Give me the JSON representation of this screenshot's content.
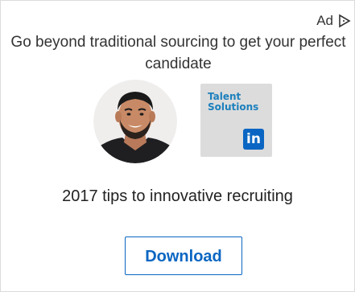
{
  "ad": {
    "label": "Ad",
    "label_icon": "play-triangle-icon",
    "headline": "Go beyond traditional sourcing to get your perfect candidate",
    "subhead": "2017 tips to innovative recruiting",
    "cta_label": "Download",
    "brand": {
      "name": "Talent Solutions",
      "icon_text": "in",
      "color": "#0a66c2",
      "tile_bg": "#dcdcdc"
    }
  }
}
